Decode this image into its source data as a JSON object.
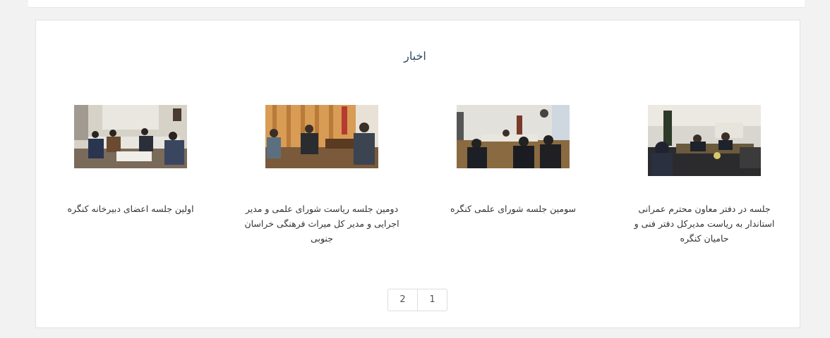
{
  "section": {
    "title": "اخبار"
  },
  "news": [
    {
      "caption": "جلسه در دفتر معاون محترم عمرانی استاندار به ریاست مدیرکل دفتر فنی و حامیان کنگره"
    },
    {
      "caption": "سومین جلسه شورای علمی کنگره"
    },
    {
      "caption": "دومین جلسه ریاست شورای علمی و مدیر اجرایی و مدیر کل میراث فرهنگی خراسان جنوبی"
    },
    {
      "caption": "اولین جلسه اعضای دبیرخانه کنگره"
    }
  ],
  "pagination": {
    "pages": [
      "2",
      "1"
    ],
    "current": "1"
  }
}
